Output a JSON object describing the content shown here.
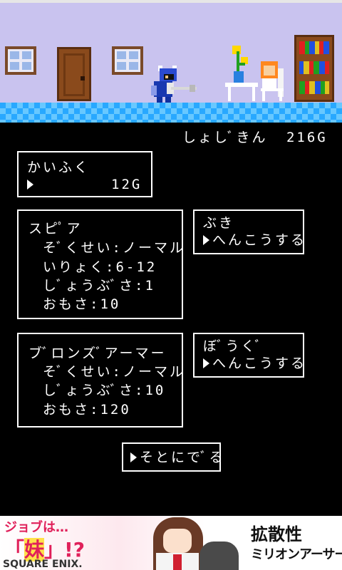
{
  "gold": {
    "label": "しょしﾞきん",
    "value": "216G"
  },
  "recovery": {
    "name": "かいふく",
    "price": "12G"
  },
  "weapon": {
    "name": "スピﾟア",
    "attribute": "そﾞくせい:ノーマル",
    "power": "いりょく:6-12",
    "durability": "しﾞょうぶﾞさ:1",
    "weight": "おもさ:10",
    "category": "ぶき",
    "change_label": "へんこうする"
  },
  "armor": {
    "name": "ブﾞロンズﾞアーマー",
    "attribute": "そﾞくせい:ノーマル",
    "durability": "しﾞょうぶﾞさ:10",
    "weight": "おもさ:120",
    "category": "ぼﾞうくﾞ",
    "change_label": "へんこうする"
  },
  "exit_label": "そとにでﾞる",
  "ad": {
    "headline": "ジョブは…",
    "quote_left": "「",
    "highlight": "妹",
    "quote_right": "」!?",
    "brand": "SQUARE ENIX.",
    "title_top": "拡散性",
    "title_bottom": "ミリオンアーサー"
  },
  "colors": {
    "sky": "#c9c3ef",
    "floor": "#28a8ff",
    "text": "#ffffff",
    "background": "#000000"
  }
}
